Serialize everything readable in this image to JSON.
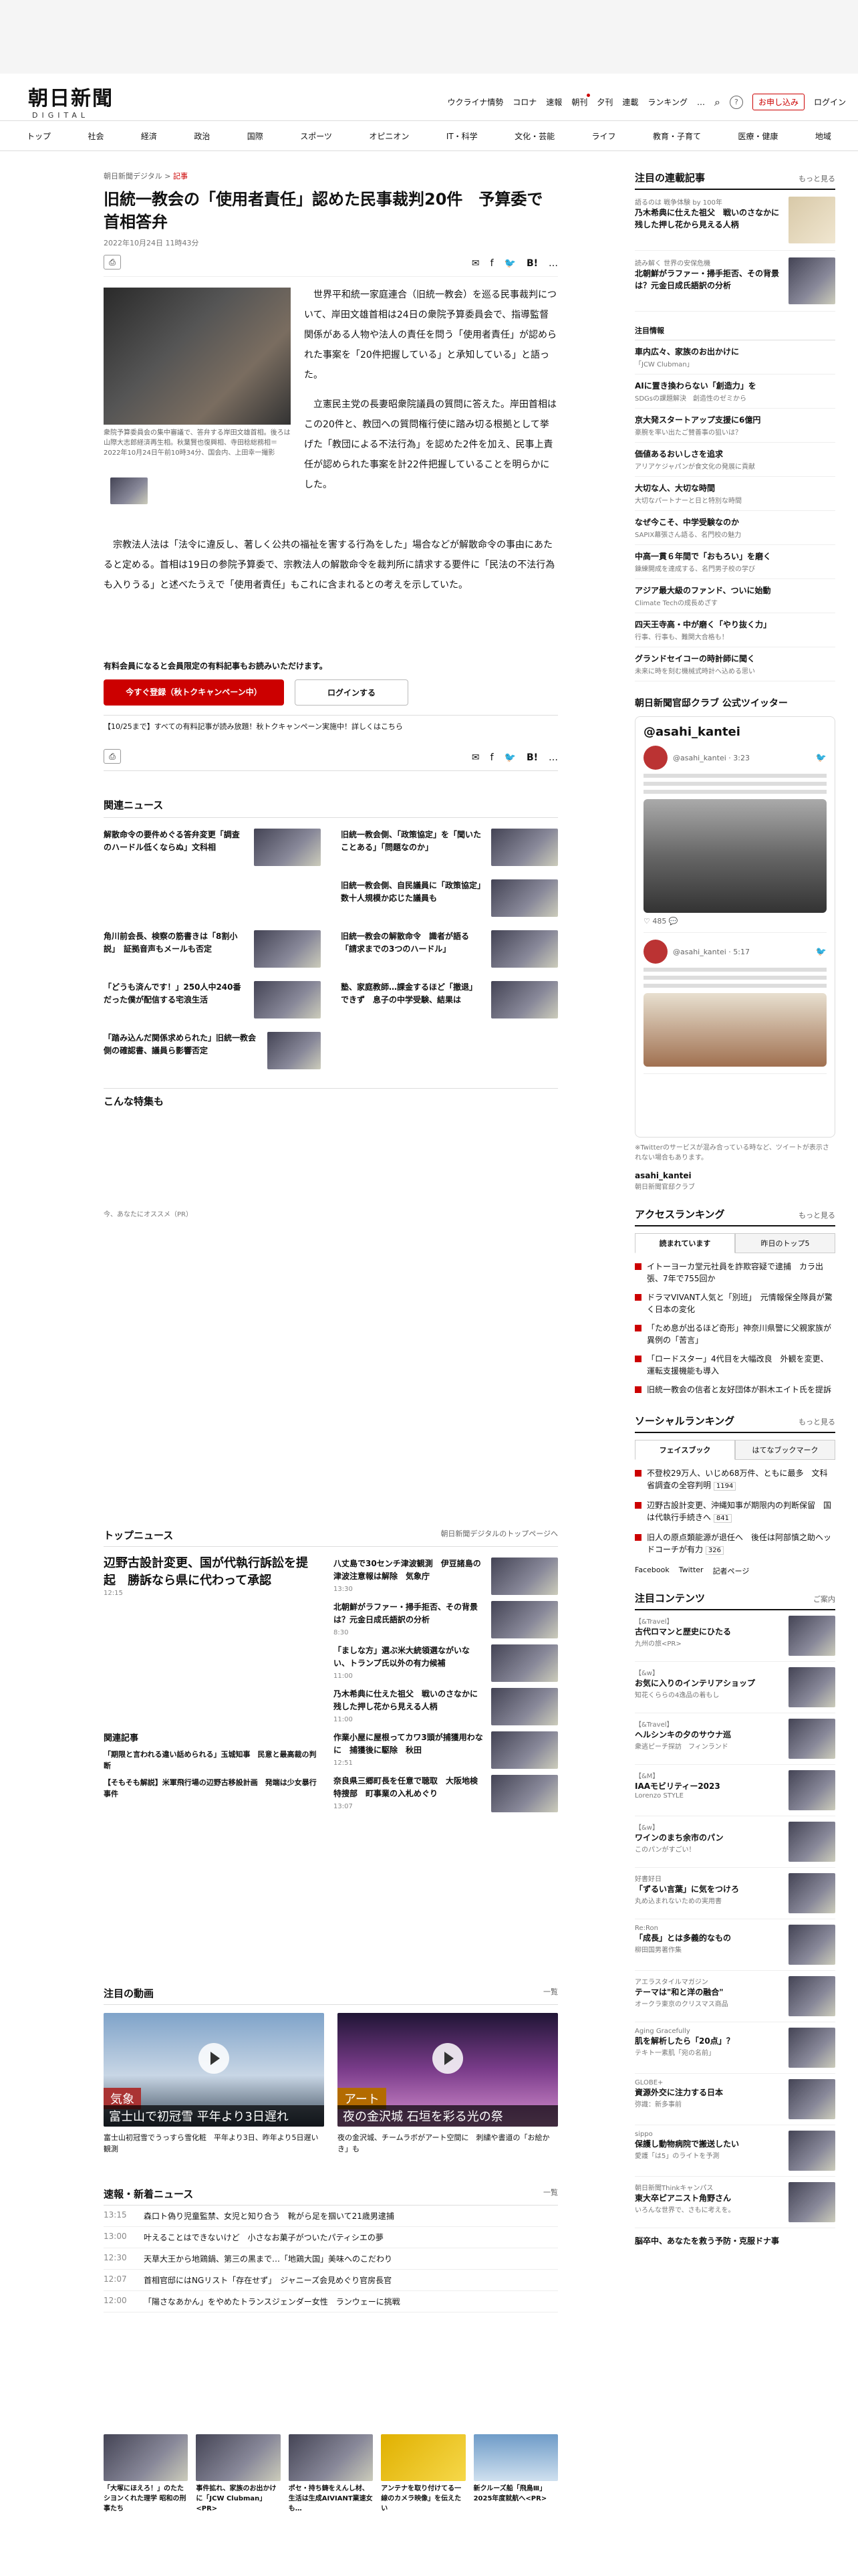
{
  "header": {
    "logo_main": "朝日新聞",
    "logo_sub": "DIGITAL",
    "links": [
      "ウクライナ情勢",
      "コロナ",
      "速報",
      "朝刊",
      "夕刊",
      "連載",
      "ランキング",
      "…"
    ],
    "signup": "お申し込み",
    "login": "ログイン"
  },
  "nav": [
    "トップ",
    "社会",
    "経済",
    "政治",
    "国際",
    "スポーツ",
    "オピニオン",
    "IT・科学",
    "文化・芸能",
    "ライフ",
    "教育・子育て",
    "医療・健康",
    "地域"
  ],
  "article": {
    "crumb_site": "朝日新聞デジタル",
    "crumb_type": "記事",
    "title": "旧統一教会の「使用者責任」認めた民事裁判20件　予算委で首相答弁",
    "date": "2022年10月24日 11時43分",
    "photo_caption": "衆院予算委員会の集中審議で、答弁する岸田文雄首相。後ろは山際大志郎経済再生相。秋葉賢也復興相、寺田稔総務相＝2022年10月24日午前10時34分、国会内、上田幸一撮影",
    "para1": "世界平和統一家庭連合（旧統一教会）を巡る民事裁判について、岸田文雄首相は24日の衆院予算委員会で、指導監督関係がある人物や法人の責任を問う「使用者責任」が認められた事案を「20件把握している」と承知している」と語った。",
    "para2": "立憲民主党の長妻昭衆院議員の質問に答えた。岸田首相はこの20件と、教団への質問権行使に踏み切る根拠として挙げた「教団による不法行為」を認めた2件を加え、民事上責任が認められた事案を計22件把握していることを明らかにした。",
    "para3": "宗教法人法は「法令に違反し、著しく公共の福祉を害する行為をした」場合などが解散命令の事由にあたると定める。首相は19日の参院予算委で、宗教法人の解散命令を裁判所に請求する要件に「民法の不法行為も入りうる」と述べたうえで「使用者責任」もこれに含まれるとの考えを示していた。",
    "paywall_note": "有料会員になると会員限定の有料記事もお読みいただけます。",
    "subscribe_btn": "今すぐ登録（秋トクキャンペーン中）",
    "login_btn": "ログインする",
    "campaign": "【10/25まで】すべての有料記事が読み放題！秋トクキャンペーン実施中！詳しくはこちら",
    "share_count": "0"
  },
  "related": {
    "title": "関連ニュース",
    "items": [
      "解散命令の要件めぐる答弁変更「調査のハードル低くならぬ」文科相",
      "旧統一教会側、「政策協定」を「聞いたことある」「問題なのか」",
      "",
      "旧統一教会側、自民議員に「政策協定」　数十人規模か応じた議員も",
      "角川前会長、検察の筋書きは「8割小説」　証拠音声もメールも否定",
      "旧統一教会の解散命令　識者が語る「請求までの3つのハードル」",
      "「どうも済んです！」250人中240番だった僕が配信する宅浪生活",
      "塾、家庭教師…課金するほど「撤退」できず　息子の中学受験、結果は",
      "「踏み込んだ関係求められた」旧統一教会側の確認書、議員ら影響否定",
      ""
    ]
  },
  "special": {
    "title": "こんな特集も",
    "pr": "今、あなたにオススメ（PR）"
  },
  "top_news": {
    "title": "トップニュース",
    "more": "朝日新聞デジタルのトップページへ",
    "lead": "辺野古設計変更、国が代執行訴訟を提起　勝訴なら県に代わって承認",
    "lead_time": "12:15",
    "items": [
      {
        "t": "八丈島で30センチ津波観測　伊豆諸島の津波注意報は解除　気象庁",
        "tm": "13:30"
      },
      {
        "t": "北朝鮮がラファー・掃手拒否、その背景は？元金日成氏語訳の分析",
        "tm": "8:30"
      },
      {
        "t": "「ましな方」選ぶ米大統領選ながいない、トランプ氏以外の有力候補",
        "tm": "11:00"
      },
      {
        "t": "乃木希典に仕えた祖父　戦いのさなかに残した押し花から見える人柄",
        "tm": "11:00"
      },
      {
        "t": "作業小屋に屋根ってカワ3頭が捕獲用わなに　捕獲後に駆除　秋田",
        "tm": "12:51"
      },
      {
        "t": "奈良県三郷町長を任意で聴取　大阪地検特捜部　町事業の入札めぐり",
        "tm": "13:07"
      }
    ],
    "related_title": "関連記事",
    "related": [
      "「期限と言われる違い話められる」玉城知事　民意と最高裁の判断",
      "【そもそも解説】米軍飛行場の辺野古移設計画　発端は少女暴行事件"
    ]
  },
  "videos": {
    "title": "注目の動画",
    "more": "一覧",
    "items": [
      {
        "label": "気象",
        "title": "富士山で初冠雪 平年より3日遅れ",
        "desc": "富士山初冠雪でうっすら雪化粧　平年より3日、昨年より5日遅い観測"
      },
      {
        "label": "アート",
        "title": "夜の金沢城 石垣を彩る光の祭",
        "desc": "夜の金沢城、チームラボがアート空間に　刺繍や書道の「お絵かき」も"
      }
    ]
  },
  "breaking": {
    "title": "速報・新着ニュース",
    "more": "一覧",
    "items": [
      {
        "tm": "13:15",
        "t": "森口ト偽り児童監禁、女児と知り合う　靴がら足を掴いて21歳男逮捕"
      },
      {
        "tm": "13:00",
        "t": "叶えることはできないけど　小さなお菓子がついたパティシエの夢"
      },
      {
        "tm": "12:30",
        "t": "天草大王から地鶏鍋、第三の黒まで…「地鶏大国」美味へのこだわり"
      },
      {
        "tm": "12:07",
        "t": "首相官邸にはNGリスト「存在せず」　ジャニーズ会見めぐり官房長官"
      },
      {
        "tm": "12:00",
        "t": "「陽さなあかん」をやめたトランスジェンダー女性　ランウェーに挑戦"
      }
    ]
  },
  "footer_items": [
    "「大塚にほえろ！」のたたシヨンくれた理学 昭和の刑事たち",
    "事件拡れ、家族のお出かけに「JCW Clubman」<PR>",
    "ポセ・持ち鋳をえんし材、生活は生成AIVIANT業速女も…",
    "アンテナを取り付けてる一線のカメラ映像」を伝えたい",
    "新クルーズ船「飛鳥Ⅲ」2025年度就航へ<PR>"
  ],
  "side": {
    "watch_title": "注目の連載記事",
    "watch_more": "もっと見る",
    "watch": [
      {
        "s": "語るのは 戦争体験 by 100年",
        "t": "乃木希典に仕えた祖父　戦いのさなかに残した押し花から見える人柄"
      },
      {
        "s": "読み解く 世界の安保危機",
        "t": "北朝鮮がラファー・掃手拒否、その背景は？元金日成氏語訳の分析"
      }
    ],
    "info_title": "注目情報",
    "info": [
      {
        "t": "車内広々、家族のお出かけに",
        "s": "「JCW Clubman」"
      },
      {
        "t": "AIに置き換わらない「創造力」を",
        "s": "SDGsの課題解決　創造性のゼミから"
      },
      {
        "t": "京大発スタートアップ支援に6億円",
        "s": "豪腕を率い出たご賛善事の狙いは？"
      },
      {
        "t": "価値あるおいしさを追求",
        "s": "アリアケジャパンが食文化の発展に貢献"
      },
      {
        "t": "大切な人、大切な時間",
        "s": "大切なパートナーと日と特別な時間"
      },
      {
        "t": "なぜ今こそ、中学受験なのか",
        "s": "SAPIX幕張さん語る、名門校の魅力"
      },
      {
        "t": "中高一貫６年間で「おもろい」を磨く",
        "s": "錬練開成を達成する、名門男子校の学び"
      },
      {
        "t": "アジア最大級のファンド、ついに始動",
        "s": "Climate Techの成長めざす"
      },
      {
        "t": "四天王寺高・中が磨く「やり抜く力」",
        "s": "行事、行事も、難関大合格も！"
      },
      {
        "t": "グランドセイコーの時計師に聞く",
        "s": "未来に時を刻む機械式時計へ込める思い"
      }
    ],
    "twitter_title": "朝日新聞官邸クラブ 公式ツイッター",
    "twitter_handle": "@asahi_kantei",
    "tweet_time1": "3:23",
    "tweet_time2": "5:17",
    "tw_likes": "485",
    "tw_note": "※Twitterのサービスが混み合っている時など、ツイートが表示されない場合もあります。",
    "tw_account": "asahi_kantei",
    "tw_account_sub": "朝日新聞官邸クラブ",
    "access_title": "アクセスランキング",
    "access_more": "もっと見る",
    "access_tabs": [
      "読まれています",
      "昨日のトップ5"
    ],
    "access": [
      "イトーヨーカ堂元社員を詐欺容疑で逮捕　カラ出張、7年で755回か",
      "ドラマVIVANT人気と「別班」　元情報保全隊員が驚く日本の変化",
      "「ため息が出るほど奇形」神奈川県警に父親家族が異例の「苦言」",
      "「ロードスター」4代目を大幅改良　外観を変更、運転支援機能も導入",
      "旧統一教会の信者と友好団体が斟木エイト氏を提訴"
    ],
    "social_title": "ソーシャルランキング",
    "social_more": "もっと見る",
    "social_tabs": [
      "フェイスブック",
      "はてなブックマーク"
    ],
    "social": [
      {
        "t": "不登校29万人、いじめ68万件、ともに最多　文科省調査の全容判明",
        "n": "1194"
      },
      {
        "t": "辺野古設計変更、沖縄知事が期限内の判断保留　国は代執行手続きへ",
        "n": "841"
      },
      {
        "t": "旧人の原点類能源が退任へ　後任は阿部慎之助ヘッドコーチが有力",
        "n": "326"
      }
    ],
    "social_links": [
      "Facebook",
      "Twitter",
      "記者ページ"
    ],
    "contents_title": "注目コンテンツ",
    "contents_more": "ご案内",
    "contents": [
      {
        "s": "【&Travel】",
        "t": "古代ロマンと歴史にひたる",
        "d": "九州の旅<PR>"
      },
      {
        "s": "【&w】",
        "t": "お気に入りのインテリアショップ",
        "d": "知花くららの4逸品の着もし"
      },
      {
        "s": "【&Travel】",
        "t": "ヘルシンキの夕のサウナ巡",
        "d": "衆逃ピーチ探訪　フィンランド"
      },
      {
        "s": "【&M】",
        "t": "IAAモビリティー2023",
        "d": "Lorenzo STYLE"
      },
      {
        "s": "【&w】",
        "t": "ワインのまち余市のパン",
        "d": "このパンがすごい！"
      },
      {
        "s": "好書好日",
        "t": "「ずるい言葉」に気をつけろ",
        "d": "丸め込まれないための実用書"
      },
      {
        "s": "Re:Ron",
        "t": "「成長」とは多義的なもの",
        "d": "柳田国男著作集"
      },
      {
        "s": "アエラスタイルマガジン",
        "t": "テーマは\"和と洋の融合\"",
        "d": "オークラ東京のクリスマス商品"
      },
      {
        "s": "Aging Gracefully",
        "t": "肌を解析したら「20点」？",
        "d": "テキト一素肌「宛の名前」"
      },
      {
        "s": "GLOBE+",
        "t": "資源外交に注力する日本",
        "d": "弥識：新多事前"
      },
      {
        "s": "sippo",
        "t": "保護し動物病院で搬送したい",
        "d": "愛護「は5」のライトを予測"
      },
      {
        "s": "朝日新聞Thinkキャンパス",
        "t": "東大卒ピアニスト角野さん",
        "d": "いろんな世界で、さもに考えを。"
      }
    ],
    "bottom_note": "脳卒中、あなたを救う予防・克服ドナ事"
  }
}
